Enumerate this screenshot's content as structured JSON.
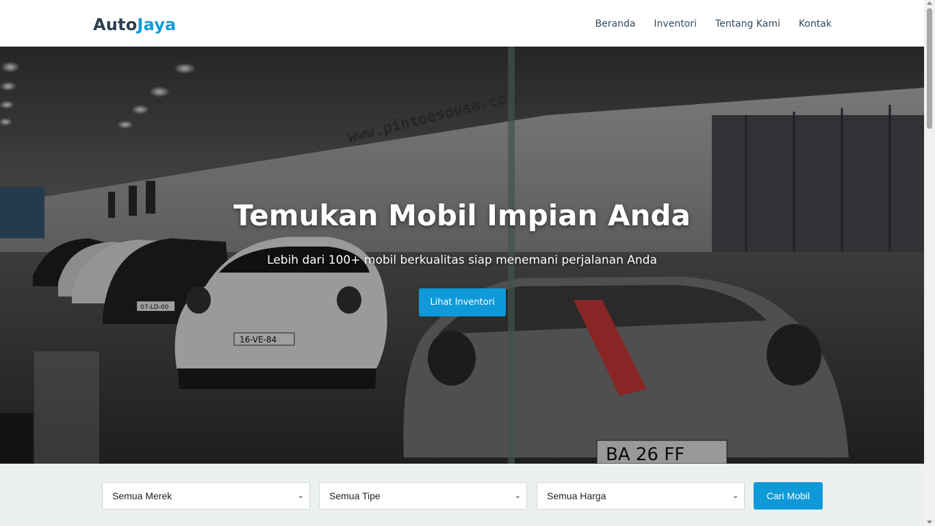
{
  "header": {
    "logo_part1": "Auto",
    "logo_part2": "Jaya",
    "nav": [
      "Beranda",
      "Inventori",
      "Tentang Kami",
      "Kontak"
    ]
  },
  "hero": {
    "title": "Temukan Mobil Impian Anda",
    "subtitle": "Lebih dari 100+ mobil berkualitas siap menemani perjalanan Anda",
    "button_label": "Lihat Inventori",
    "background_description_icon": "car-showroom-photo",
    "wall_text": "www.pintoesousa.com",
    "plate_left": "16-VE-84",
    "plate_back": "07-LD-00",
    "plate_right": "BA 26 FF"
  },
  "filter": {
    "brand_select": "Semua Merek",
    "type_select": "Semua Tipe",
    "price_select": "Semua Harga",
    "search_label": "Cari Mobil"
  },
  "colors": {
    "brand_dark": "#2c3e50",
    "brand_accent": "#119ad6",
    "button_blue": "#0e9ad8",
    "filter_bg": "#ecf0f1"
  }
}
